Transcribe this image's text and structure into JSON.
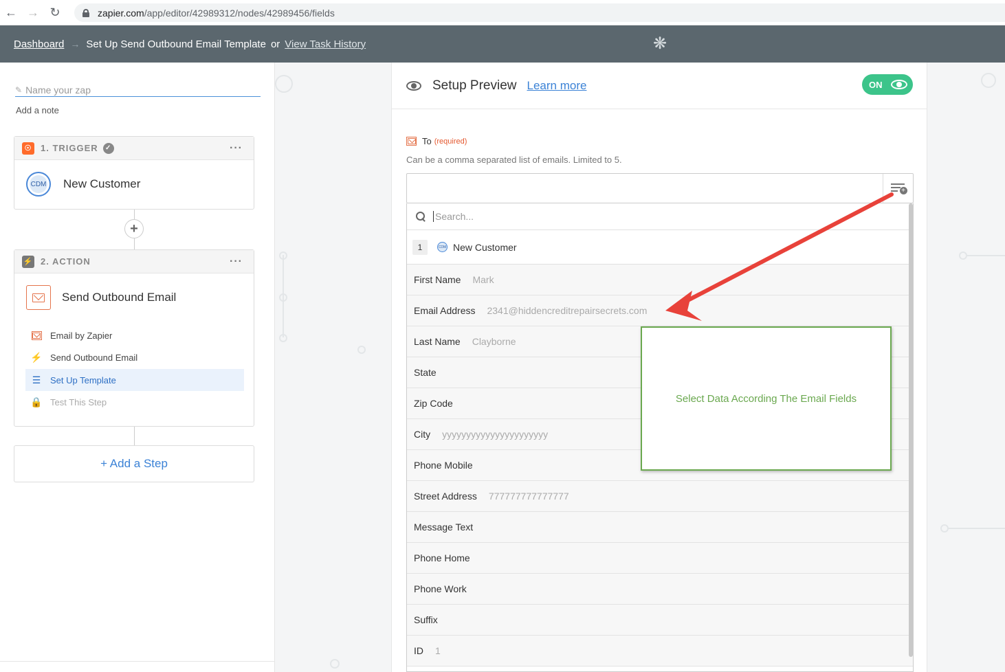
{
  "browser": {
    "url_host": "zapier.com",
    "url_path": "/app/editor/42989312/nodes/42989456/fields"
  },
  "header": {
    "dashboard_label": "Dashboard",
    "arrow": "→",
    "page_title": "Set Up Send Outbound Email Template",
    "or_label": "or",
    "task_history_label": "View Task History"
  },
  "sidebar": {
    "zap_name_placeholder": "Name your zap",
    "add_note_label": "Add a note",
    "trigger": {
      "heading": "1. TRIGGER",
      "app_logo_text": "CDM",
      "app_label": "New Customer",
      "menu": "···"
    },
    "action": {
      "heading": "2. ACTION",
      "app_label": "Send Outbound Email",
      "menu": "···",
      "sub_items": [
        {
          "label": "Email by Zapier",
          "icon": "mail-icon",
          "state": "normal"
        },
        {
          "label": "Send Outbound Email",
          "icon": "bolt-icon",
          "state": "normal"
        },
        {
          "label": "Set Up Template",
          "icon": "list-icon",
          "state": "active"
        },
        {
          "label": "Test This Step",
          "icon": "lock-icon",
          "state": "disabled"
        }
      ]
    },
    "add_step_label": "+ Add a Step"
  },
  "panel": {
    "title": "Setup Preview",
    "learn_more_label": "Learn more",
    "toggle_label": "ON",
    "field": {
      "label": "To",
      "required_label": "(required)",
      "help": "Can be a comma separated list of emails. Limited to 5."
    },
    "dropdown": {
      "search_placeholder": "Search...",
      "group": {
        "number": "1",
        "logo_text": "CDM",
        "name": "New Customer"
      },
      "rows": [
        {
          "name": "First Name",
          "value": "Mark"
        },
        {
          "name": "Email Address",
          "value": "2341@hiddencreditrepairsecrets.com"
        },
        {
          "name": "Last Name",
          "value": "Clayborne"
        },
        {
          "name": "State",
          "value": ""
        },
        {
          "name": "Zip Code",
          "value": ""
        },
        {
          "name": "City",
          "value": "yyyyyyyyyyyyyyyyyyyyyy"
        },
        {
          "name": "Phone Mobile",
          "value": ""
        },
        {
          "name": "Street Address",
          "value": "777777777777777"
        },
        {
          "name": "Message Text",
          "value": ""
        },
        {
          "name": "Phone Home",
          "value": ""
        },
        {
          "name": "Phone Work",
          "value": ""
        },
        {
          "name": "Suffix",
          "value": ""
        },
        {
          "name": "ID",
          "value": "1"
        }
      ]
    }
  },
  "annotation": {
    "text": "Select Data According The Email Fields",
    "box_color": "#6aa84f",
    "arrow_color": "#e8423a"
  },
  "colors": {
    "header_bg": "#5b676e",
    "accent_blue": "#3b82d6",
    "toggle_green": "#3cc48a",
    "zapier_orange": "#ff6b2b"
  }
}
